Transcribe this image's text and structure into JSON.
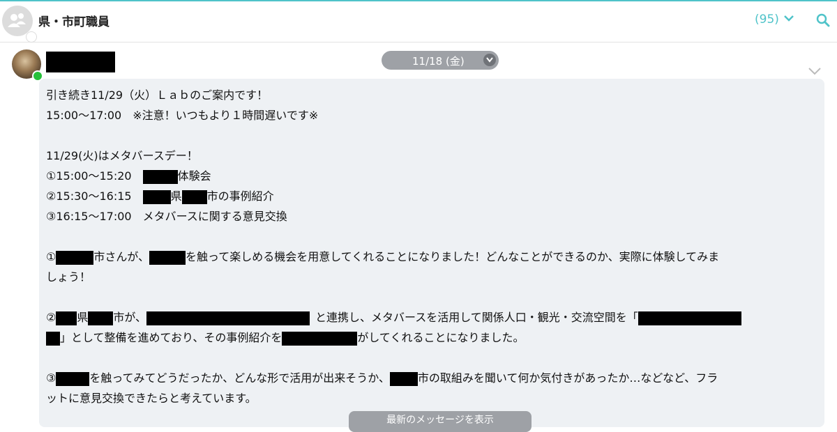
{
  "header": {
    "group_name": "県・市町職員",
    "member_count": "(95)",
    "accent_color": "#4fc3c9"
  },
  "message": {
    "date": "11/18 (金)",
    "lines": {
      "l1": "引き続き11/29（火）Ｌａｂのご案内です！",
      "l2": "15:00～17:00　※注意！いつもより１時間遅いです※",
      "l3": "11/29(火)はメタバースデー！",
      "l4a": "①15:00～15:20　",
      "l4b": "体験会",
      "l5a": "②15:30～16:15　",
      "l5b": "県",
      "l5c": "市の事例紹介",
      "l6": "③16:15～17:00　メタバースに関する意見交換",
      "l7a": "①",
      "l7b": "市さんが、",
      "l7c": "を触って楽しめる機会を用意してくれることになりました！どんなことができるのか、実際に体験してみま",
      "l8": "しょう！",
      "l9a": "②",
      "l9b": "県",
      "l9c": "市が、",
      "l9d": "と連携し、メタバースを活用して関係人口・観光・交流空間を「",
      "l10a": "」として整備を進めており、その事例紹介を",
      "l10b": "がしてくれることになりました。",
      "l11a": "③",
      "l11b": "を触ってみてどうだったか、どんな形で活用が出来そうか、",
      "l11c": "市の取組みを聞いて何か気付きがあったか…などなど、フラ",
      "l12": "ットに意見交換できたらと考えています。"
    }
  },
  "footer": {
    "newest_button": "最新のメッセージを表示"
  },
  "icons": {
    "group_avatar": "group-avatar-icon",
    "dropdown": "chevron-down-icon",
    "search": "search-icon",
    "online": "online-status-dot"
  }
}
